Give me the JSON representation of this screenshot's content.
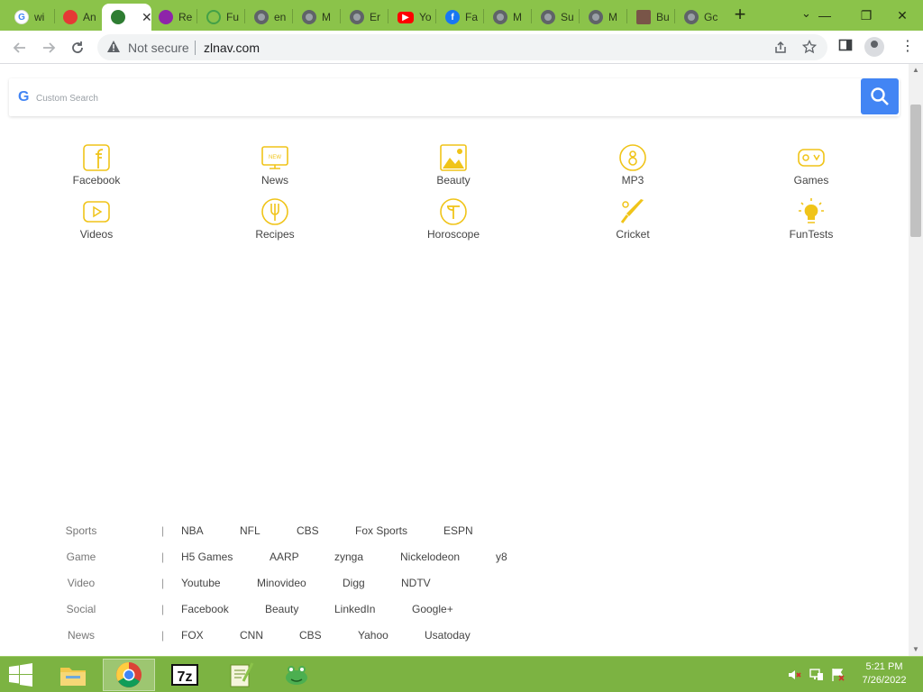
{
  "browser": {
    "tabs": [
      {
        "title": "wi",
        "icon": "google-icon",
        "active": false
      },
      {
        "title": "An",
        "icon": "pokeball-icon",
        "active": false
      },
      {
        "title": "",
        "icon": "globe-leaf-icon",
        "active": true
      },
      {
        "title": "Re",
        "icon": "purple-app-icon",
        "active": false
      },
      {
        "title": "Fu",
        "icon": "lightbulb-icon",
        "active": false
      },
      {
        "title": "en",
        "icon": "globe-icon",
        "active": false
      },
      {
        "title": "M",
        "icon": "globe-icon",
        "active": false
      },
      {
        "title": "Er",
        "icon": "globe-icon",
        "active": false
      },
      {
        "title": "Yo",
        "icon": "youtube-icon",
        "active": false
      },
      {
        "title": "Fa",
        "icon": "facebook-icon",
        "active": false
      },
      {
        "title": "M",
        "icon": "globe-icon",
        "active": false
      },
      {
        "title": "Su",
        "icon": "globe-icon",
        "active": false
      },
      {
        "title": "M",
        "icon": "globe-icon",
        "active": false
      },
      {
        "title": "Bu",
        "icon": "image-icon",
        "active": false
      },
      {
        "title": "Gc",
        "icon": "globe-icon",
        "active": false
      }
    ],
    "new_tab_label": "+",
    "security_label": "Not secure",
    "url": "zlnav.com"
  },
  "search": {
    "placeholder": "Custom Search",
    "brand_mark": "G",
    "button_icon": "search-icon"
  },
  "categories": [
    {
      "label": "Facebook",
      "icon": "facebook-icon"
    },
    {
      "label": "News",
      "icon": "news-icon"
    },
    {
      "label": "Beauty",
      "icon": "beauty-icon"
    },
    {
      "label": "MP3",
      "icon": "mp3-icon"
    },
    {
      "label": "Games",
      "icon": "gamepad-icon"
    },
    {
      "label": "Videos",
      "icon": "video-icon"
    },
    {
      "label": "Recipes",
      "icon": "recipes-icon"
    },
    {
      "label": "Horoscope",
      "icon": "horoscope-icon"
    },
    {
      "label": "Cricket",
      "icon": "cricket-icon"
    },
    {
      "label": "FunTests",
      "icon": "lightbulb-icon"
    }
  ],
  "link_rows": [
    {
      "name": "Sports",
      "links": [
        "NBA",
        "NFL",
        "CBS",
        "Fox Sports",
        "ESPN"
      ]
    },
    {
      "name": "Game",
      "links": [
        "H5 Games",
        "AARP",
        "zynga",
        "Nickelodeon",
        "y8"
      ]
    },
    {
      "name": "Video",
      "links": [
        "Youtube",
        "Minovideo",
        "Digg",
        "NDTV"
      ]
    },
    {
      "name": "Social",
      "links": [
        "Facebook",
        "Beauty",
        "LinkedIn",
        "Google+"
      ]
    },
    {
      "name": "News",
      "links": [
        "FOX",
        "CNN",
        "CBS",
        "Yahoo",
        "Usatoday"
      ]
    }
  ],
  "link_separator": "|",
  "taskbar": {
    "items": [
      {
        "name": "file-explorer-icon",
        "active": false
      },
      {
        "name": "chrome-icon",
        "active": true
      },
      {
        "name": "7zip-icon",
        "active": false
      },
      {
        "name": "notepad-plus-plus-icon",
        "active": false
      },
      {
        "name": "frog-app-icon",
        "active": false
      }
    ],
    "time": "5:21 PM",
    "date": "7/26/2022"
  },
  "colors": {
    "tab_strip": "#8bc34a",
    "taskbar": "#7cb342",
    "search_button": "#4285f4",
    "category_icon": "#f0c419"
  }
}
